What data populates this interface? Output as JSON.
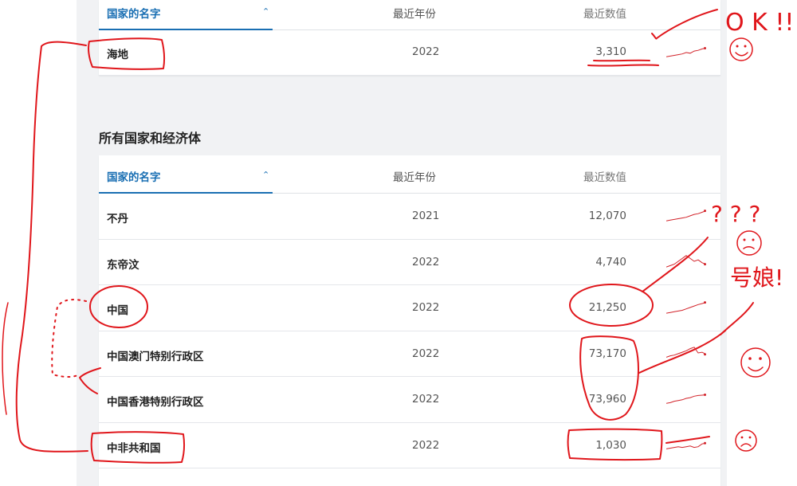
{
  "top_table": {
    "header": {
      "name": "国家的名字",
      "year": "最近年份",
      "value": "最近数值"
    },
    "rows": [
      {
        "name": "海地",
        "year": "2022",
        "value": "3,310",
        "trend": [
          0.15,
          0.2,
          0.25,
          0.3,
          0.35,
          0.45,
          0.4,
          0.55,
          0.6,
          0.7,
          0.75
        ]
      }
    ]
  },
  "section": {
    "title": "所有国家和经济体"
  },
  "main_table": {
    "header": {
      "name": "国家的名字",
      "year": "最近年份",
      "value": "最近数值"
    },
    "rows": [
      {
        "name": "不丹",
        "year": "2021",
        "value": "12,070",
        "trend": [
          0.1,
          0.15,
          0.2,
          0.25,
          0.3,
          0.35,
          0.45,
          0.55,
          0.6,
          0.7,
          0.8
        ]
      },
      {
        "name": "东帝汶",
        "year": "2022",
        "value": "4,740",
        "trend": [
          0.1,
          0.2,
          0.3,
          0.5,
          0.7,
          0.9,
          0.7,
          0.5,
          0.6,
          0.4,
          0.3
        ]
      },
      {
        "name": "中国",
        "year": "2022",
        "value": "21,250",
        "trend": [
          0.05,
          0.1,
          0.15,
          0.2,
          0.25,
          0.35,
          0.45,
          0.55,
          0.65,
          0.72,
          0.8
        ]
      },
      {
        "name": "中国澳门特别行政区",
        "year": "2022",
        "value": "73,170",
        "trend": [
          0.2,
          0.3,
          0.35,
          0.45,
          0.55,
          0.65,
          0.8,
          0.9,
          0.5,
          0.55,
          0.4
        ]
      },
      {
        "name": "中国香港特别行政区",
        "year": "2022",
        "value": "73,960",
        "trend": [
          0.15,
          0.2,
          0.3,
          0.35,
          0.4,
          0.5,
          0.55,
          0.65,
          0.7,
          0.72,
          0.75
        ]
      },
      {
        "name": "中非共和国",
        "year": "2022",
        "value": "1,030",
        "trend": [
          0.2,
          0.25,
          0.3,
          0.35,
          0.3,
          0.35,
          0.4,
          0.3,
          0.35,
          0.55,
          0.6
        ]
      }
    ]
  },
  "annotations": {
    "ok_note": "O K !!!",
    "question_marks": "? ? ?",
    "side_note": "号娘!"
  },
  "colors": {
    "accent": "#1a6fb3",
    "ink": "#e0161b",
    "spark": "#d2232a"
  }
}
